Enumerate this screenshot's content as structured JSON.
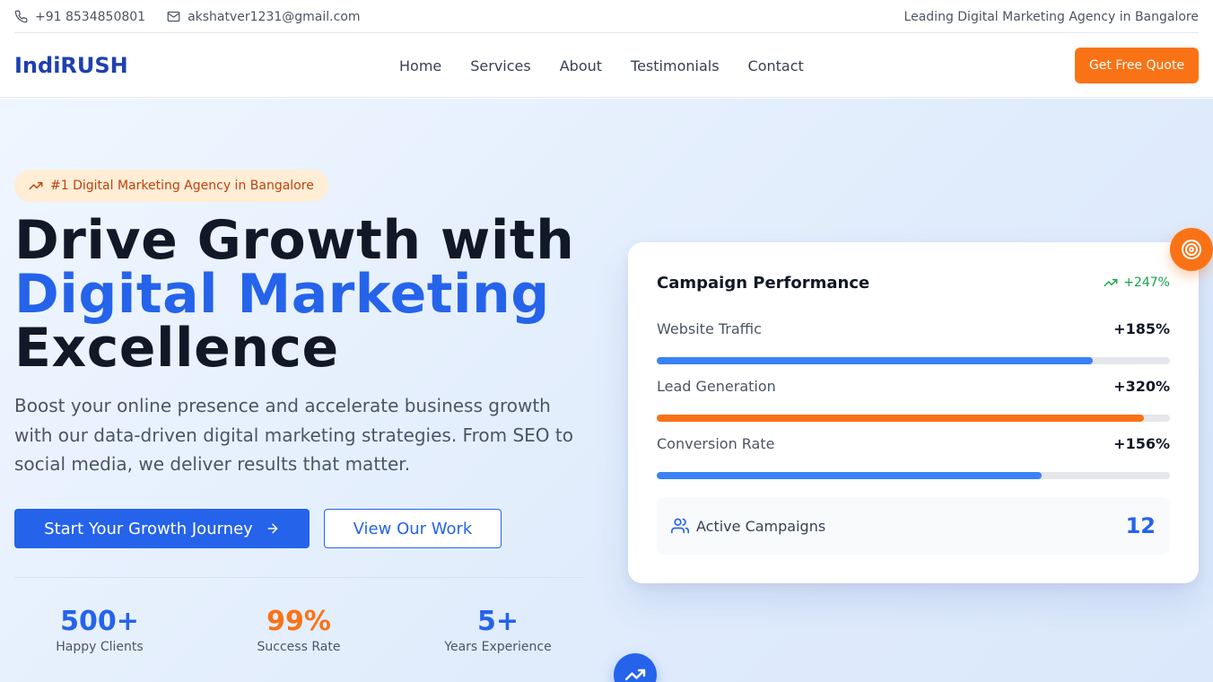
{
  "topbar": {
    "phone": "+91 8534850801",
    "email": "akshatver1231@gmail.com",
    "tagline": "Leading Digital Marketing Agency in Bangalore"
  },
  "nav": {
    "logo": "IndiRUSH",
    "links": [
      "Home",
      "Services",
      "About",
      "Testimonials",
      "Contact"
    ],
    "cta": "Get Free Quote"
  },
  "hero": {
    "badge": "#1 Digital Marketing Agency in Bangalore",
    "headline_1": "Drive Growth with",
    "headline_accent": "Digital Marketing",
    "headline_3": "Excellence",
    "lead": "Boost your online presence and accelerate business growth with our data-driven digital marketing strategies. From SEO to social media, we deliver results that matter.",
    "primary_cta": "Start Your Growth Journey",
    "secondary_cta": "View Our Work",
    "stats": [
      {
        "value": "500+",
        "label": "Happy Clients",
        "color": "#2563eb"
      },
      {
        "value": "99%",
        "label": "Success Rate",
        "color": "#f97316"
      },
      {
        "value": "5+",
        "label": "Years Experience",
        "color": "#2563eb"
      }
    ]
  },
  "card": {
    "title": "Campaign Performance",
    "growth": "+247%",
    "metrics": [
      {
        "name": "Website Traffic",
        "value": "+185%",
        "progress": 0.85,
        "color": "#3b82f6"
      },
      {
        "name": "Lead Generation",
        "value": "+320%",
        "progress": 0.95,
        "color": "#f97316"
      },
      {
        "name": "Conversion Rate",
        "value": "+156%",
        "progress": 0.75,
        "color": "#3b82f6"
      }
    ],
    "active_label": "Active Campaigns",
    "active_count": "12"
  },
  "icons": {
    "phone": "phone-icon",
    "email": "mail-icon",
    "trend": "trending-up-icon",
    "arrow": "arrow-right-icon",
    "users": "users-icon",
    "target": "target-icon"
  },
  "colors": {
    "brand": "#1e40af",
    "primary": "#2563eb",
    "accent": "#f97316",
    "success": "#16a34a"
  }
}
